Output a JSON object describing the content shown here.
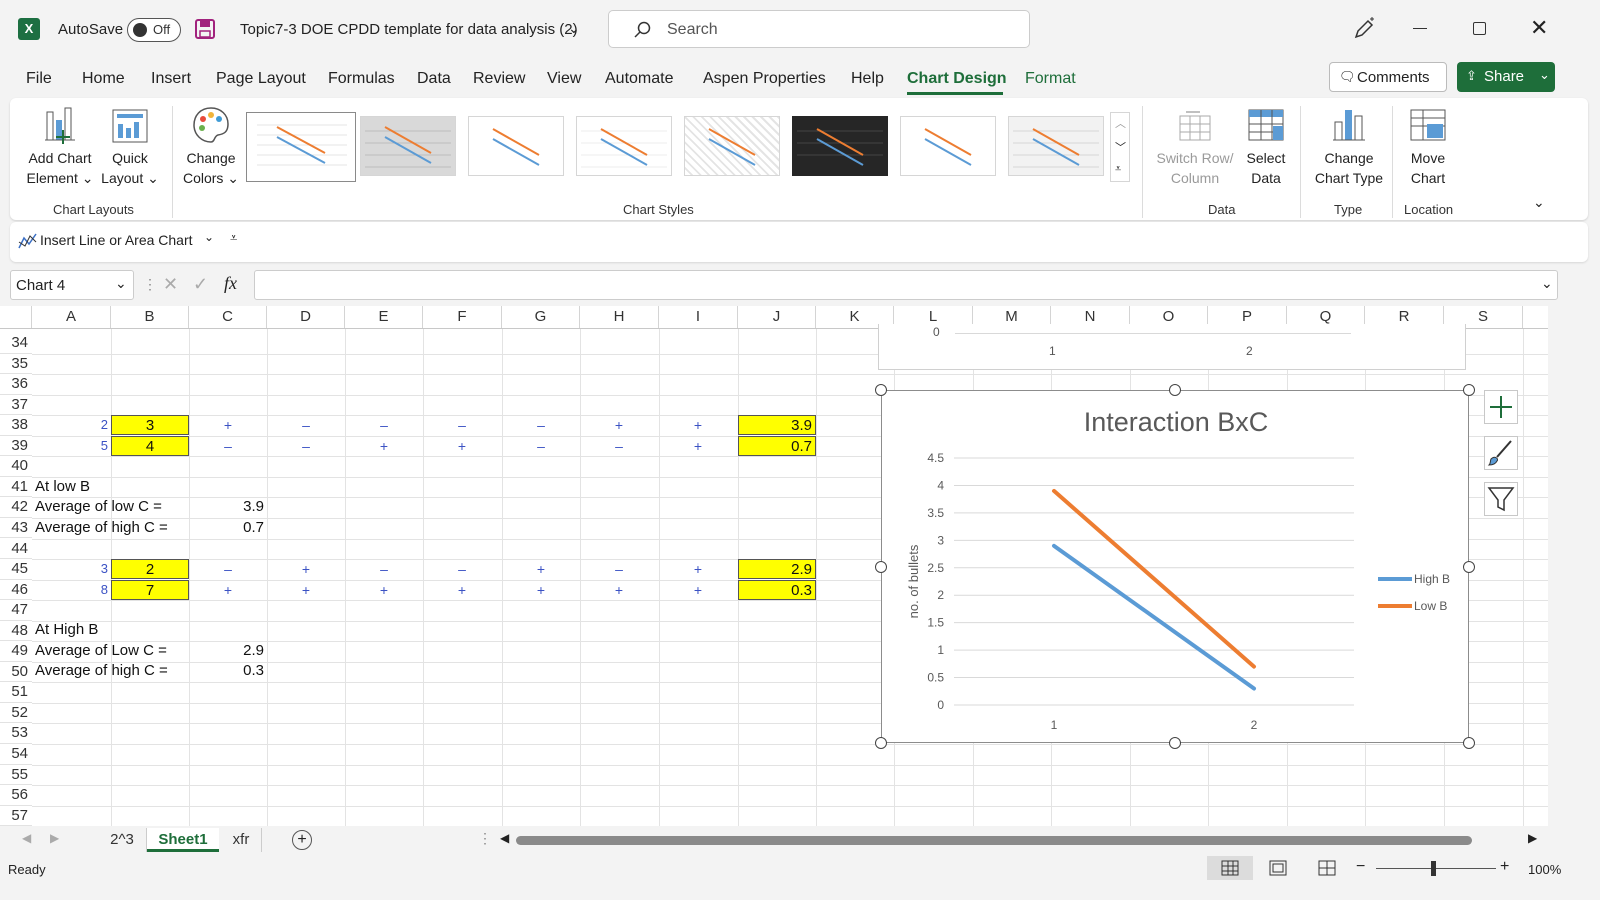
{
  "app": {
    "autosave_label": "AutoSave",
    "autosave_state": "Off",
    "doc_title": "Topic7-3 DOE CPDD template for data analysis (2)",
    "search_placeholder": "Search",
    "accent_color": "#1e6e3a"
  },
  "menu": {
    "tabs": [
      "File",
      "Home",
      "Insert",
      "Page Layout",
      "Formulas",
      "Data",
      "Review",
      "View",
      "Automate",
      "Aspen Properties",
      "Help",
      "Chart Design",
      "Format"
    ],
    "active_tab": "Chart Design",
    "comments_label": "Comments",
    "share_label": "Share"
  },
  "ribbon": {
    "add_chart_element": [
      "Add Chart",
      "Element ⌄"
    ],
    "quick_layout": [
      "Quick",
      "Layout ⌄"
    ],
    "change_colors": [
      "Change",
      "Colors ⌄"
    ],
    "chart_layouts_group": "Chart Layouts",
    "chart_styles_group": "Chart Styles",
    "switch_row_col": [
      "Switch Row/",
      "Column"
    ],
    "select_data": [
      "Select",
      "Data"
    ],
    "data_group": "Data",
    "change_chart_type": [
      "Change",
      "Chart Type"
    ],
    "type_group": "Type",
    "move_chart": [
      "Move",
      "Chart"
    ],
    "location_group": "Location"
  },
  "qat": {
    "insert_chart_label": "Insert Line or Area Chart"
  },
  "formula_bar": {
    "name_box": "Chart 4",
    "fx": "fx",
    "formula": ""
  },
  "sheet": {
    "columns": [
      "A",
      "B",
      "C",
      "D",
      "E",
      "F",
      "G",
      "H",
      "I",
      "J",
      "K",
      "L",
      "M",
      "N",
      "O",
      "P",
      "Q",
      "R",
      "S"
    ],
    "rows": [
      "34",
      "35",
      "36",
      "37",
      "38",
      "39",
      "40",
      "41",
      "42",
      "43",
      "44",
      "45",
      "46",
      "47",
      "48",
      "49",
      "50",
      "51",
      "52",
      "53",
      "54",
      "55",
      "56",
      "57"
    ],
    "cells": {
      "a38": "2",
      "b38": "3",
      "j38": "3.9",
      "a39": "5",
      "b39": "4",
      "j39": "0.7",
      "a41": "At low B",
      "a42": "Average of low C =",
      "c42": "3.9",
      "a43": "Average of high C =",
      "c43": "0.7",
      "a45": "3",
      "b45": "2",
      "j45": "2.9",
      "a46": "8",
      "b46": "7",
      "j46": "0.3",
      "a48": "At High B",
      "a49": "Average of Low C =",
      "c49": "2.9",
      "a50": "Average of high C =",
      "c50": "0.3"
    },
    "signs": {
      "r38": [
        "+",
        "–",
        "–",
        "–",
        "–",
        "+",
        "+"
      ],
      "r39": [
        "–",
        "–",
        "+",
        "+",
        "–",
        "–",
        "+"
      ],
      "r45": [
        "–",
        "+",
        "–",
        "–",
        "+",
        "–",
        "+"
      ],
      "r46": [
        "+",
        "+",
        "+",
        "+",
        "+",
        "+",
        "+"
      ]
    },
    "partial_chart": {
      "y_tick": "0",
      "x_ticks": [
        "1",
        "2"
      ]
    }
  },
  "chart_data": {
    "type": "line",
    "title": "Interaction BxC",
    "ylabel": "no. of bullets",
    "xlabel": "",
    "x": [
      "1",
      "2"
    ],
    "ylim": [
      0,
      4.5
    ],
    "yticks": [
      "0",
      "0.5",
      "1",
      "1.5",
      "2",
      "2.5",
      "3",
      "3.5",
      "4",
      "4.5"
    ],
    "series": [
      {
        "name": "High B",
        "values": [
          2.9,
          0.3
        ],
        "color": "#5b9bd5"
      },
      {
        "name": "Low B",
        "values": [
          3.9,
          0.7
        ],
        "color": "#ed7d31"
      }
    ],
    "legend": "right",
    "grid": true
  },
  "sheet_tabs": {
    "tabs": [
      "2^3",
      "Sheet1",
      "xfr"
    ],
    "active": "Sheet1"
  },
  "status": {
    "ready": "Ready",
    "zoom": "100%"
  }
}
